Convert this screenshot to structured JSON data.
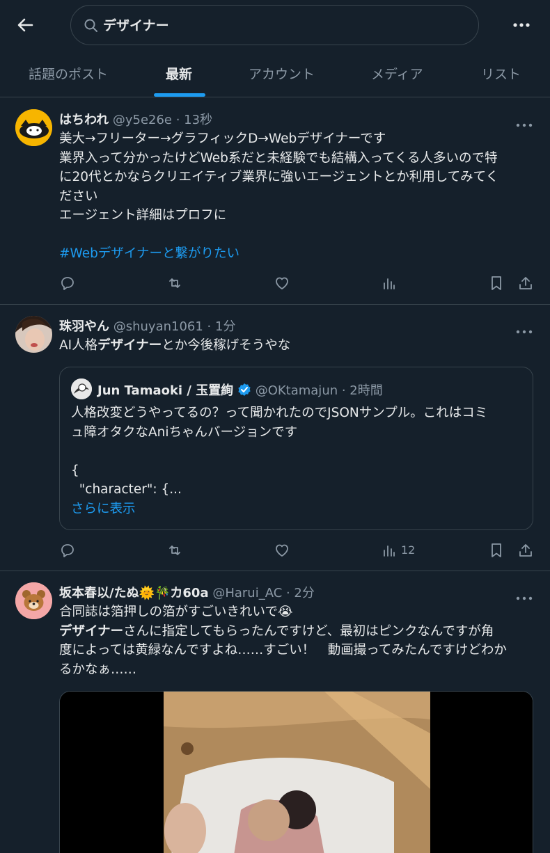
{
  "search": {
    "query": "デザイナー"
  },
  "tabs": [
    {
      "label": "話題のポスト",
      "active": false
    },
    {
      "label": "最新",
      "active": true
    },
    {
      "label": "アカウント",
      "active": false
    },
    {
      "label": "メディア",
      "active": false
    },
    {
      "label": "リスト",
      "active": false
    }
  ],
  "posts": [
    {
      "name": "はちわれ",
      "meta": "@y5e26e · 13秒",
      "lines": [
        "美大→フリーター→グラフィックD→Webデザイナーです",
        "業界入って分かったけどWeb系だと未経験でも結構入ってくる人多いので特",
        "に20代とかならクリエイティブ業界に強いエージェントとか利用してみてく",
        "ださい",
        "エージェント詳細はプロフに"
      ],
      "hashtag": "#Webデザイナーと繋がりたい",
      "views": ""
    },
    {
      "name": "珠羽やん",
      "meta": "@shuyan1061 · 1分",
      "line1_prefix": "AI人格",
      "line1_bold": "デザイナー",
      "line1_suffix": "とか今後稼げそうやな",
      "quote": {
        "name": "Jun Tamaoki / 玉置絢",
        "meta": "@OKtamajun · 2時間",
        "text1": "人格改変どうやってるの？って聞かれたのでJSONサンプル。これはコミ",
        "text2": "ュ障オタクなAniちゃんバージョンです",
        "code1": "{",
        "code2": "  \"character\": {...",
        "show_more": "さらに表示"
      },
      "views": "12"
    },
    {
      "name": "坂本春以/たぬ🌞🎋カ60a",
      "meta": "@Harui_AC · 2分",
      "line1": "合同誌は箔押しの箔がすごいきれいで😭",
      "line2_bold": "デザイナー",
      "line2_rest": "さんに指定してもらったんですけど、最初はピンクなんですが角",
      "line3": "度によっては黄緑なんですよね……すごい！　動画撮ってみたんですけどわか",
      "line4": "るかなぁ……"
    }
  ],
  "colors": {
    "background": "#15202b",
    "accent": "#1d9bf0",
    "border": "#38444d",
    "secondary_text": "#8b98a5"
  }
}
